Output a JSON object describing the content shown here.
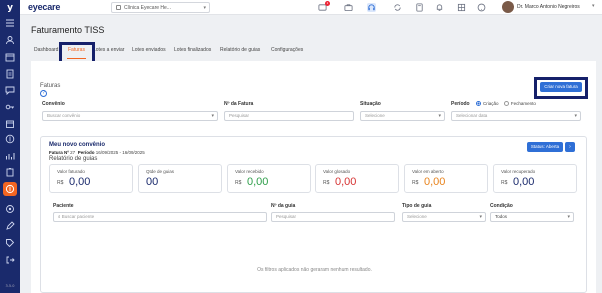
{
  "app": {
    "brand": "eyecare",
    "rail_logo": "y",
    "rail_footer": "3.5.0"
  },
  "header": {
    "clinic": "Clínica Eyecare He...",
    "notif_badge": "1",
    "user_name": "Dr. Marco Antonio Negreiros"
  },
  "page": {
    "title": "Faturamento TISS"
  },
  "tabs": [
    {
      "label": "Dashboard"
    },
    {
      "label": "Faturas"
    },
    {
      "label": "Lotes a enviar"
    },
    {
      "label": "Lotes enviados"
    },
    {
      "label": "Lotes finalizados"
    },
    {
      "label": "Relatório de guias"
    },
    {
      "label": "Configurações"
    }
  ],
  "faturas": {
    "section_title": "Faturas",
    "create_button": "Criar nova fatura",
    "filters": {
      "convenio": {
        "label": "Convênio",
        "placeholder": "Buscar convênio"
      },
      "numero": {
        "label": "Nº da Fatura",
        "placeholder": "Pesquisar"
      },
      "situacao": {
        "label": "Situação",
        "placeholder": "Selecione"
      },
      "periodo": {
        "label": "Período",
        "opt_criacao": "Criação",
        "opt_fechamento": "Fechamento",
        "placeholder": "Selecionar data"
      }
    }
  },
  "card": {
    "title": "Meu novo convênio",
    "fatura_label": "Fatura Nº",
    "fatura_num": "27",
    "periodo_label": "Período",
    "periodo": "16/09/2025 - 16/09/2025",
    "subtitle": "Relatório de guias",
    "status_button": "Status: Aberta",
    "stats": [
      {
        "label": "Valor faturado",
        "currency": "R$",
        "value": "0,00",
        "color": "#1a2a6c"
      },
      {
        "label": "Qtde de guias",
        "currency": "",
        "value": "00",
        "color": "#1a2a6c"
      },
      {
        "label": "Valor recebido",
        "currency": "R$",
        "value": "0,00",
        "color": "#2e9e4a"
      },
      {
        "label": "Valor glosado",
        "currency": "R$",
        "value": "0,00",
        "color": "#d63333"
      },
      {
        "label": "Valor em aberto",
        "currency": "R$",
        "value": "0,00",
        "color": "#e8831d"
      },
      {
        "label": "Valor recuperado",
        "currency": "R$",
        "value": "0,00",
        "color": "#1a2a6c"
      }
    ],
    "filters": {
      "paciente": {
        "label": "Paciente",
        "placeholder": "Buscar paciente"
      },
      "guia": {
        "label": "Nº da guia",
        "placeholder": "Pesquisar"
      },
      "tipo": {
        "label": "Tipo de guia",
        "placeholder": "Selecione"
      },
      "condicao": {
        "label": "Condição",
        "value": "Todos"
      }
    },
    "empty_message": "Os filtros aplicados não geraram nenhum resultado."
  }
}
